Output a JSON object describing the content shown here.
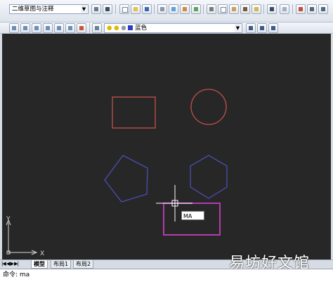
{
  "toolbar": {
    "workspace": "二维草图与注释",
    "layer_name": "蓝色"
  },
  "colors": {
    "canvas_bg": "#272727",
    "rectangle": "#c2504a",
    "circle": "#c2504a",
    "pentagon": "#4a4fb0",
    "hexagon": "#4a4fb0",
    "selection": "#b43bb0",
    "crosshair": "#ffffff"
  },
  "canvas": {
    "dynamic_input": "MA",
    "ucs_x": "X",
    "ucs_y": "Y"
  },
  "tabs": [
    "模型",
    "布局1",
    "布局2"
  ],
  "command_line": "命令: ma",
  "watermark": "易坊好文馆"
}
